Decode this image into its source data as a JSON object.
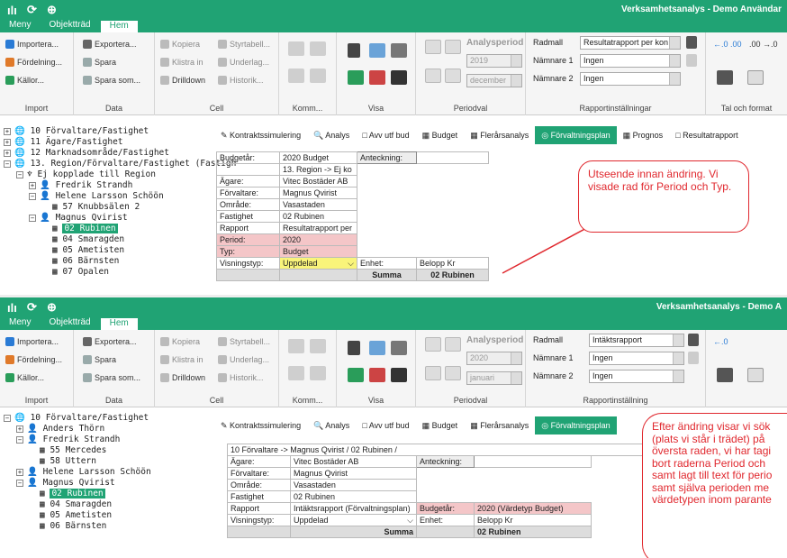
{
  "window1": {
    "app_title": "Verksamhetsanalys - Demo Användar",
    "tabs": [
      "Meny",
      "Objektträd",
      "Hem"
    ],
    "ribbon": {
      "import": {
        "label": "Import",
        "items": [
          "Importera...",
          "Fördelning...",
          "Källor..."
        ]
      },
      "data": {
        "label": "Data",
        "items": [
          "Exportera...",
          "Spara",
          "Spara som..."
        ]
      },
      "cell": {
        "label": "Cell",
        "items": [
          "Kopiera",
          "Klistra in",
          "Drilldown",
          "Styrtabell...",
          "Underlag...",
          "Historik..."
        ]
      },
      "komm": {
        "label": "Komm..."
      },
      "visa": {
        "label": "Visa"
      },
      "periodval": {
        "label": "Periodval",
        "analysperiod": "Analysperiod",
        "year": "2019",
        "month": "december"
      },
      "rapport": {
        "label": "Rapportinställningar",
        "radmall_label": "Radmall",
        "radmall_value": "Resultatrapport per kon",
        "namnare1_label": "Nämnare 1",
        "namnare1_value": "Ingen",
        "namnare2_label": "Nämnare 2",
        "namnare2_value": "Ingen"
      },
      "tal": {
        "label": "Tal och format",
        "dec_inc": "←.0 .00",
        "dec_dec": ".00 →.0"
      }
    },
    "tree": [
      {
        "text": "10 Förvaltare/Fastighet"
      },
      {
        "text": "11 Ägare/Fastighet"
      },
      {
        "text": "12 Marknadsområde/Fastighet"
      },
      {
        "text": "13. Region/Förvaltare/Fastighet (Fastigh"
      },
      {
        "text": "Ej kopplade till Region"
      },
      {
        "text": "Fredrik Strandh"
      },
      {
        "text": "Helene Larsson Schöön"
      },
      {
        "text": "57 Knubbsälen 2"
      },
      {
        "text": "Magnus Qvirist"
      },
      {
        "text": "02 Rubinen"
      },
      {
        "text": "04 Smaragden"
      },
      {
        "text": "05 Ametisten"
      },
      {
        "text": "06 Bärnsten"
      },
      {
        "text": "07 Opalen"
      }
    ],
    "view_tabs": [
      "Kontraktssimulering",
      "Analys",
      "Avv utf bud",
      "Budget",
      "Flerårsanalys",
      "Förvaltningsplan",
      "Prognos",
      "Resultatrapport"
    ],
    "active_view_tab": "Förvaltningsplan",
    "grid": {
      "rows": [
        [
          "Budgetår:",
          "2020 Budget"
        ],
        [
          "",
          "13. Region -> Ej ko"
        ],
        [
          "Ägare:",
          "Vitec Bostäder AB"
        ],
        [
          "Förvaltare:",
          "Magnus Qvirist"
        ],
        [
          "Område:",
          "Vasastaden"
        ],
        [
          "Fastighet",
          "02 Rubinen"
        ],
        [
          "Rapport",
          "Resultatrapport per"
        ],
        [
          "Period:",
          "2020"
        ],
        [
          "Typ:",
          "Budget"
        ],
        [
          "Visningstyp:",
          "Uppdelad"
        ]
      ],
      "anteckning": "Anteckning:",
      "enhet_label": "Enhet:",
      "enhet_value": "Belopp Kr",
      "summa": "Summa",
      "col": "02 Rubinen"
    },
    "callout": "Utseende innan ändring. Vi visade rad för Period och Typ."
  },
  "window2": {
    "app_title": "Verksamhetsanalys - Demo A",
    "tabs": [
      "Meny",
      "Objektträd",
      "Hem"
    ],
    "ribbon": {
      "import": {
        "label": "Import",
        "items": [
          "Importera...",
          "Fördelning...",
          "Källor..."
        ]
      },
      "data": {
        "label": "Data",
        "items": [
          "Exportera...",
          "Spara",
          "Spara som..."
        ]
      },
      "cell": {
        "label": "Cell",
        "items": [
          "Kopiera",
          "Klistra in",
          "Drilldown",
          "Styrtabell...",
          "Underlag...",
          "Historik..."
        ]
      },
      "komm": {
        "label": "Komm..."
      },
      "visa": {
        "label": "Visa"
      },
      "periodval": {
        "label": "Periodval",
        "analysperiod": "Analysperiod",
        "year": "2020",
        "month": "januari"
      },
      "rapport": {
        "label": "Rapportinställning",
        "radmall_label": "Radmall",
        "radmall_value": "Intäktsrapport",
        "namnare1_label": "Nämnare 1",
        "namnare1_value": "Ingen",
        "namnare2_label": "Nämnare 2",
        "namnare2_value": "Ingen"
      }
    },
    "tree": [
      {
        "text": "10 Förvaltare/Fastighet"
      },
      {
        "text": "Anders Thörn"
      },
      {
        "text": "Fredrik Strandh"
      },
      {
        "text": "55 Mercedes"
      },
      {
        "text": "58 Uttern"
      },
      {
        "text": "Helene Larsson Schöön"
      },
      {
        "text": "Magnus Qvirist"
      },
      {
        "text": "02 Rubinen"
      },
      {
        "text": "04 Smaragden"
      },
      {
        "text": "05 Ametisten"
      },
      {
        "text": "06 Bärnsten"
      }
    ],
    "view_tabs": [
      "Kontraktssimulering",
      "Analys",
      "Avv utf bud",
      "Budget",
      "Flerårsanalys",
      "Förvaltningsplan"
    ],
    "active_view_tab": "Förvaltningsplan",
    "grid": {
      "path": "10 Förvaltare -> Magnus Qvirist / 02 Rubinen /",
      "rows": [
        [
          "Ägare:",
          "Vitec Bostäder AB"
        ],
        [
          "Förvaltare:",
          "Magnus Qvirist"
        ],
        [
          "Område:",
          "Vasastaden"
        ],
        [
          "Fastighet",
          "02 Rubinen"
        ],
        [
          "Rapport",
          "Intäktsrapport (Förvaltningsplan)"
        ],
        [
          "Visningstyp:",
          "Uppdelad"
        ]
      ],
      "anteckning": "Anteckning:",
      "budgetar_label": "Budgetår:",
      "budgetar_value": "2020 (Värdetyp Budget)",
      "enhet_label": "Enhet:",
      "enhet_value": "Belopp Kr",
      "summa": "Summa",
      "col": "02 Rubinen"
    },
    "callout": "Efter ändring visar vi sök (plats vi står i trädet) på översta raden, vi har tagi bort raderna Period och samt lagt till text för perio samt själva perioden me värdetypen inom parante"
  }
}
